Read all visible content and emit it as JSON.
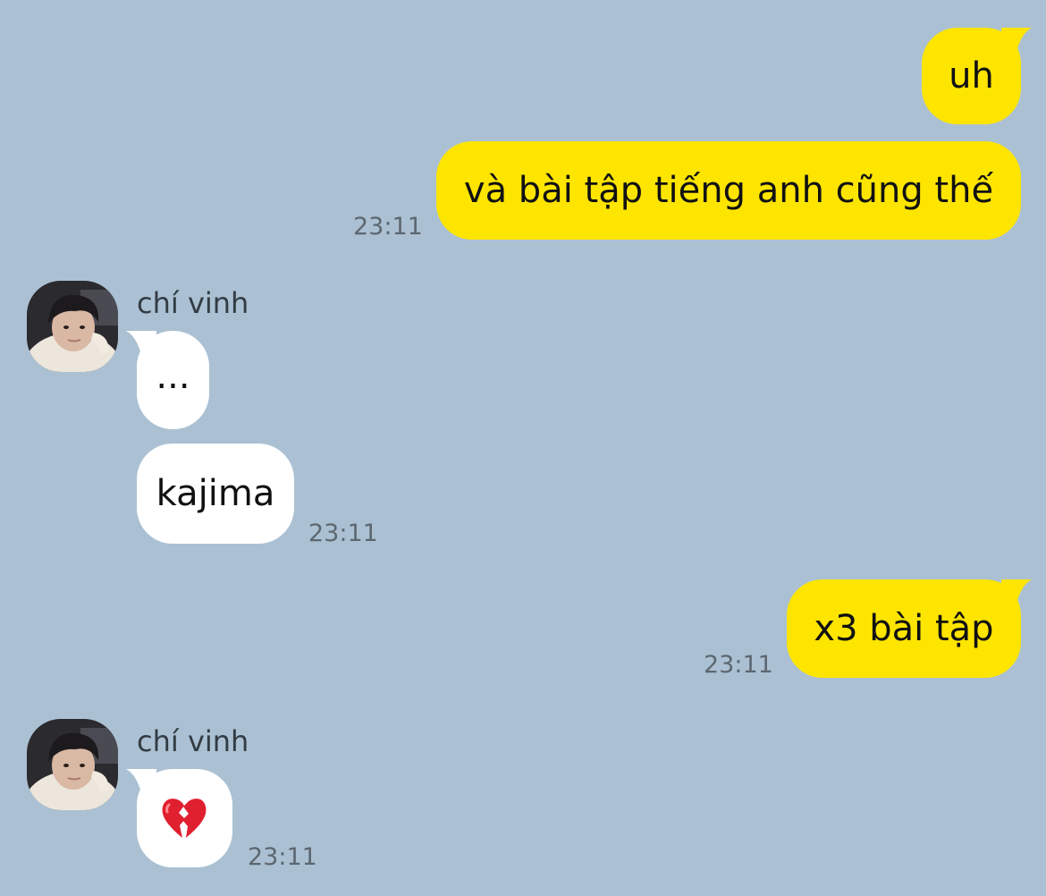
{
  "colors": {
    "background": "#abc1d3",
    "outgoing_bubble": "#fee500",
    "incoming_bubble": "#ffffff",
    "timestamp": "#5d6770"
  },
  "messages": [
    {
      "sender": "me",
      "text": "uh"
    },
    {
      "sender": "me",
      "text": "và bài tập tiếng anh cũng thế",
      "time": "23:11"
    },
    {
      "sender": "chí vinh",
      "text": "..."
    },
    {
      "sender": "chí vinh",
      "text": "kajima",
      "time": "23:11"
    },
    {
      "sender": "me",
      "text": "x3 bài tập",
      "time": "23:11"
    },
    {
      "sender": "chí vinh",
      "emoji": "broken-heart-icon",
      "time": "23:11"
    }
  ],
  "contact": {
    "name": "chí vinh",
    "avatar": "avatar"
  }
}
